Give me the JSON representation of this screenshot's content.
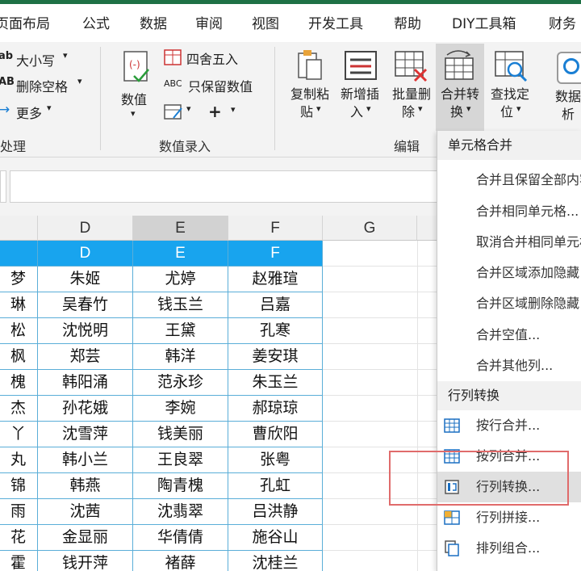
{
  "tabs": [
    "页面布局",
    "公式",
    "数据",
    "审阅",
    "视图",
    "开发工具",
    "帮助",
    "DIY工具箱",
    "财务"
  ],
  "ribbon": {
    "text_group": {
      "items": [
        "大小写",
        "删除空格",
        "更多"
      ],
      "prefix1": "ab",
      "prefix2": "AB",
      "label": "处理"
    },
    "numeric_group": {
      "big_button": "数值",
      "items": [
        "四舍五入",
        "只保留数值"
      ],
      "abc": "ABC",
      "label": "数值录入"
    },
    "edit_group": {
      "buttons": [
        {
          "line1": "复制粘",
          "line2": "贴"
        },
        {
          "line1": "新增插",
          "line2": "入"
        },
        {
          "line1": "批量删",
          "line2": "除"
        },
        {
          "line1": "合并转",
          "line2": "换"
        },
        {
          "line1": "查找定",
          "line2": "位"
        },
        {
          "line1": "数据",
          "line2": "析"
        }
      ],
      "label": "编辑"
    }
  },
  "grid": {
    "col_headers": [
      "D",
      "E",
      "F",
      "G"
    ],
    "table_header": [
      "D",
      "E",
      "F"
    ],
    "rows": [
      [
        "梦",
        "朱姬",
        "尤婷",
        "赵雅瑄"
      ],
      [
        "琳",
        "吴春竹",
        "钱玉兰",
        "吕嘉"
      ],
      [
        "松",
        "沈悦明",
        "王黛",
        "孔寒"
      ],
      [
        "枫",
        "郑芸",
        "韩洋",
        "姜安琪"
      ],
      [
        "槐",
        "韩阳涌",
        "范永珍",
        "朱玉兰"
      ],
      [
        "杰",
        "孙花娥",
        "李婉",
        "郝琼琼"
      ],
      [
        "丫",
        "沈雪萍",
        "钱美丽",
        "曹欣阳"
      ],
      [
        "丸",
        "韩小兰",
        "王良翠",
        "张粤"
      ],
      [
        "锦",
        "韩燕",
        "陶青槐",
        "孔虹"
      ],
      [
        "雨",
        "沈茜",
        "沈翡翠",
        "吕洪静"
      ],
      [
        "花",
        "金显丽",
        "华倩倩",
        "施谷山"
      ],
      [
        "霍",
        "钱开萍",
        "褚薛",
        "沈桂兰"
      ]
    ]
  },
  "menu": {
    "section1": "单元格合并",
    "items1": [
      "合并且保留全部内容",
      "合并相同单元格...",
      "取消合并相同单元格",
      "合并区域添加隐藏",
      "合并区域删除隐藏",
      "合并空值...",
      "合并其他列..."
    ],
    "section2": "行列转换",
    "items2": [
      "按行合并...",
      "按列合并...",
      "行列转换...",
      "行列拼接...",
      "排列组合..."
    ]
  },
  "colors": {
    "title_bar": "#1e7145",
    "table_header_fill": "#18a4ee",
    "table_border": "#5aaed8",
    "highlight_box": "#e06b6b"
  }
}
